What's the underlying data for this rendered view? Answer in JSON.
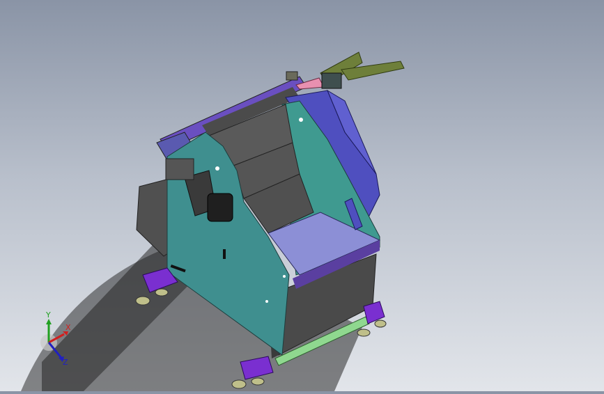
{
  "viewport": {
    "background_top": "#8a94a6",
    "background_bottom": "#e2e5ea"
  },
  "model": {
    "description_icon": "cad-machine-assembly",
    "colors": {
      "side_panel": "#3f8f8f",
      "side_panel_dark": "#2f7272",
      "hopper_blue": "#4f4fbf",
      "seat_lavender": "#8c8fd6",
      "base_gray": "#4a4a4a",
      "feet_purple": "#7a2fd0",
      "green_strip": "#8fd88f",
      "rail_olive": "#6e7f3a",
      "pink_part": "#e890b0"
    }
  },
  "triad": {
    "x_label": "X",
    "y_label": "Y",
    "z_label": "Z",
    "x_color": "#d02020",
    "y_color": "#20a020",
    "z_color": "#2020c0"
  }
}
